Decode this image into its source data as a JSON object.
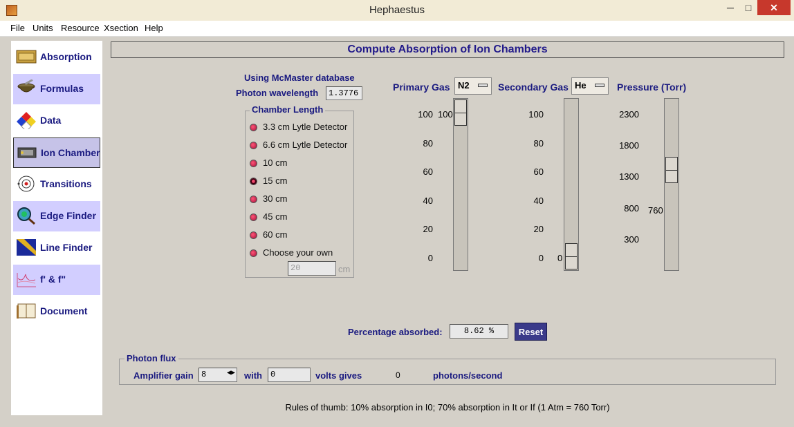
{
  "window": {
    "title": "Hephaestus",
    "min": "─",
    "max": "□",
    "close": "✕"
  },
  "menu": [
    "File",
    "Units",
    "Resource",
    "Xsection",
    "Help"
  ],
  "sidebar": {
    "items": [
      {
        "label": "Absorption",
        "icon": "gold-bar-icon"
      },
      {
        "label": "Formulas",
        "icon": "mortar-icon"
      },
      {
        "label": "Data",
        "icon": "hazard-diamond-icon"
      },
      {
        "label": "Ion Chamber",
        "icon": "ion-chamber-icon"
      },
      {
        "label": "Transitions",
        "icon": "atom-icon"
      },
      {
        "label": "Edge Finder",
        "icon": "magnifier-icon"
      },
      {
        "label": "Line Finder",
        "icon": "ruler-icon"
      },
      {
        "label": "f' & f\"",
        "icon": "graph-icon"
      },
      {
        "label": "Document",
        "icon": "book-icon"
      }
    ]
  },
  "header": {
    "title": "Compute Absorption of Ion Chambers"
  },
  "database": {
    "label": "Using McMaster database"
  },
  "wavelength": {
    "label": "Photon wavelength",
    "value": "1.3776"
  },
  "chamber": {
    "legend": "Chamber Length",
    "options": [
      "3.3 cm Lytle Detector",
      "6.6 cm Lytle Detector",
      "10 cm",
      "15 cm",
      "30 cm",
      "45 cm",
      "60 cm",
      "Choose your own"
    ],
    "selected": "15 cm",
    "custom_value": "20",
    "custom_unit": "cm"
  },
  "primary_gas": {
    "label": "Primary Gas",
    "value": "N2",
    "ticks": [
      "100",
      "80",
      "60",
      "40",
      "20",
      "0"
    ],
    "slider_value": "100",
    "level": 1.0
  },
  "secondary_gas": {
    "label": "Secondary Gas",
    "value": "He",
    "ticks": [
      "100",
      "80",
      "60",
      "40",
      "20",
      "0"
    ],
    "slider_value": "0",
    "level": 0.0
  },
  "pressure": {
    "label": "Pressure (Torr)",
    "ticks": [
      "2300",
      "1800",
      "1300",
      "800",
      "300"
    ],
    "slider_value": "760",
    "level": 0.6
  },
  "result": {
    "label": "Percentage absorbed:",
    "value": "8.62 %",
    "reset_label": "Reset"
  },
  "flux": {
    "legend": "Photon flux",
    "gain_label": "Amplifier gain",
    "gain_value": "8",
    "with_label": "with",
    "volts_value": "0",
    "gives_label": "volts gives",
    "photons_value": "0",
    "unit_label": "photons/second"
  },
  "footer": {
    "text": "Rules of thumb: 10% absorption in I0; 70% absorption in It or If  (1 Atm = 760 Torr)"
  }
}
